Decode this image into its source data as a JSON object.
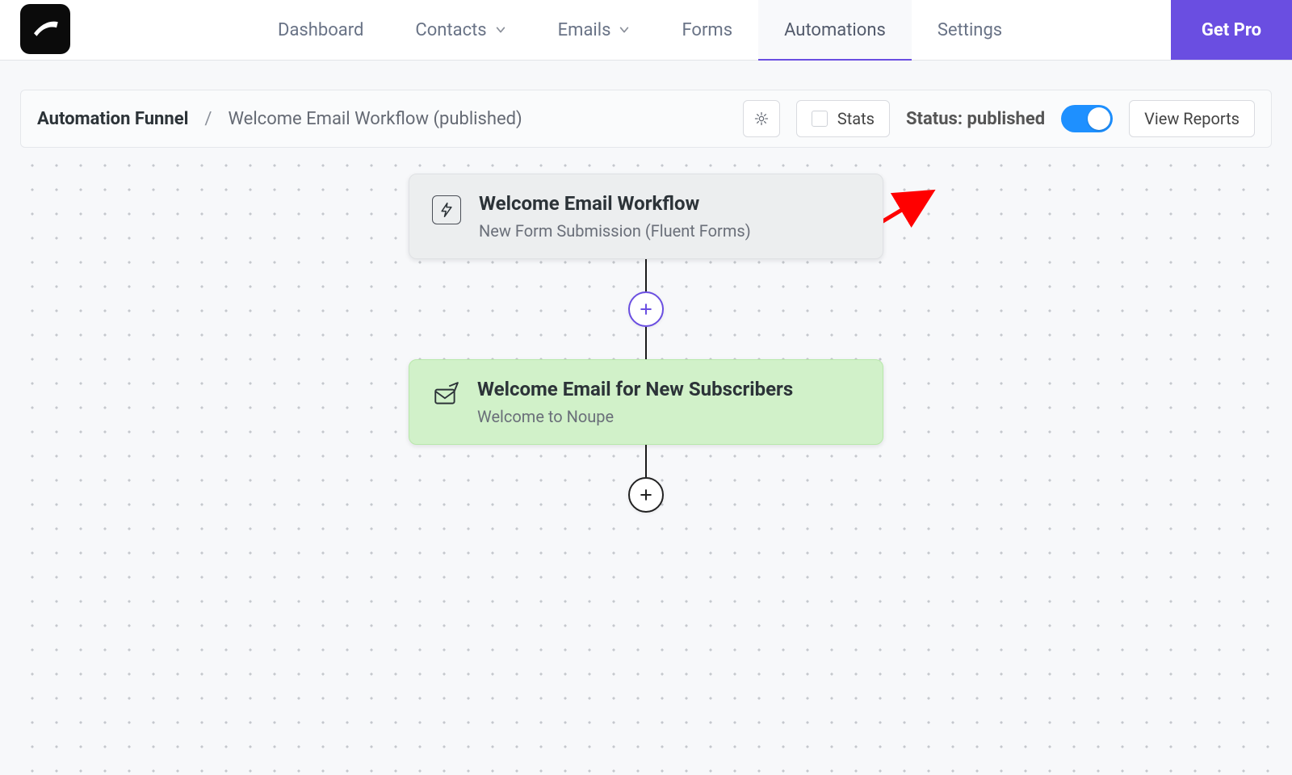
{
  "nav": {
    "items": [
      {
        "label": "Dashboard",
        "active": false,
        "has_submenu": false
      },
      {
        "label": "Contacts",
        "active": false,
        "has_submenu": true
      },
      {
        "label": "Emails",
        "active": false,
        "has_submenu": true
      },
      {
        "label": "Forms",
        "active": false,
        "has_submenu": false
      },
      {
        "label": "Automations",
        "active": true,
        "has_submenu": false
      },
      {
        "label": "Settings",
        "active": false,
        "has_submenu": false
      }
    ],
    "get_pro_label": "Get Pro"
  },
  "header": {
    "title": "Automation Funnel",
    "separator": "/",
    "subtitle": "Welcome Email Workflow (published)",
    "settings_icon": "gear-icon",
    "stats_label": "Stats",
    "status_prefix": "Status:",
    "status_value": "published",
    "status_toggle_on": true,
    "view_reports_label": "View Reports"
  },
  "flow": {
    "trigger": {
      "title": "Welcome Email Workflow",
      "subtitle": "New Form Submission (Fluent Forms)",
      "icon": "bolt-icon"
    },
    "action": {
      "title": "Welcome Email for New Subscribers",
      "subtitle": "Welcome to Noupe",
      "icon": "send-mail-icon"
    },
    "add_icon": "plus-icon"
  },
  "colors": {
    "accent_purple": "#6a4ee1",
    "toggle_blue": "#1e90ff",
    "action_bg": "#d1f1c9"
  }
}
